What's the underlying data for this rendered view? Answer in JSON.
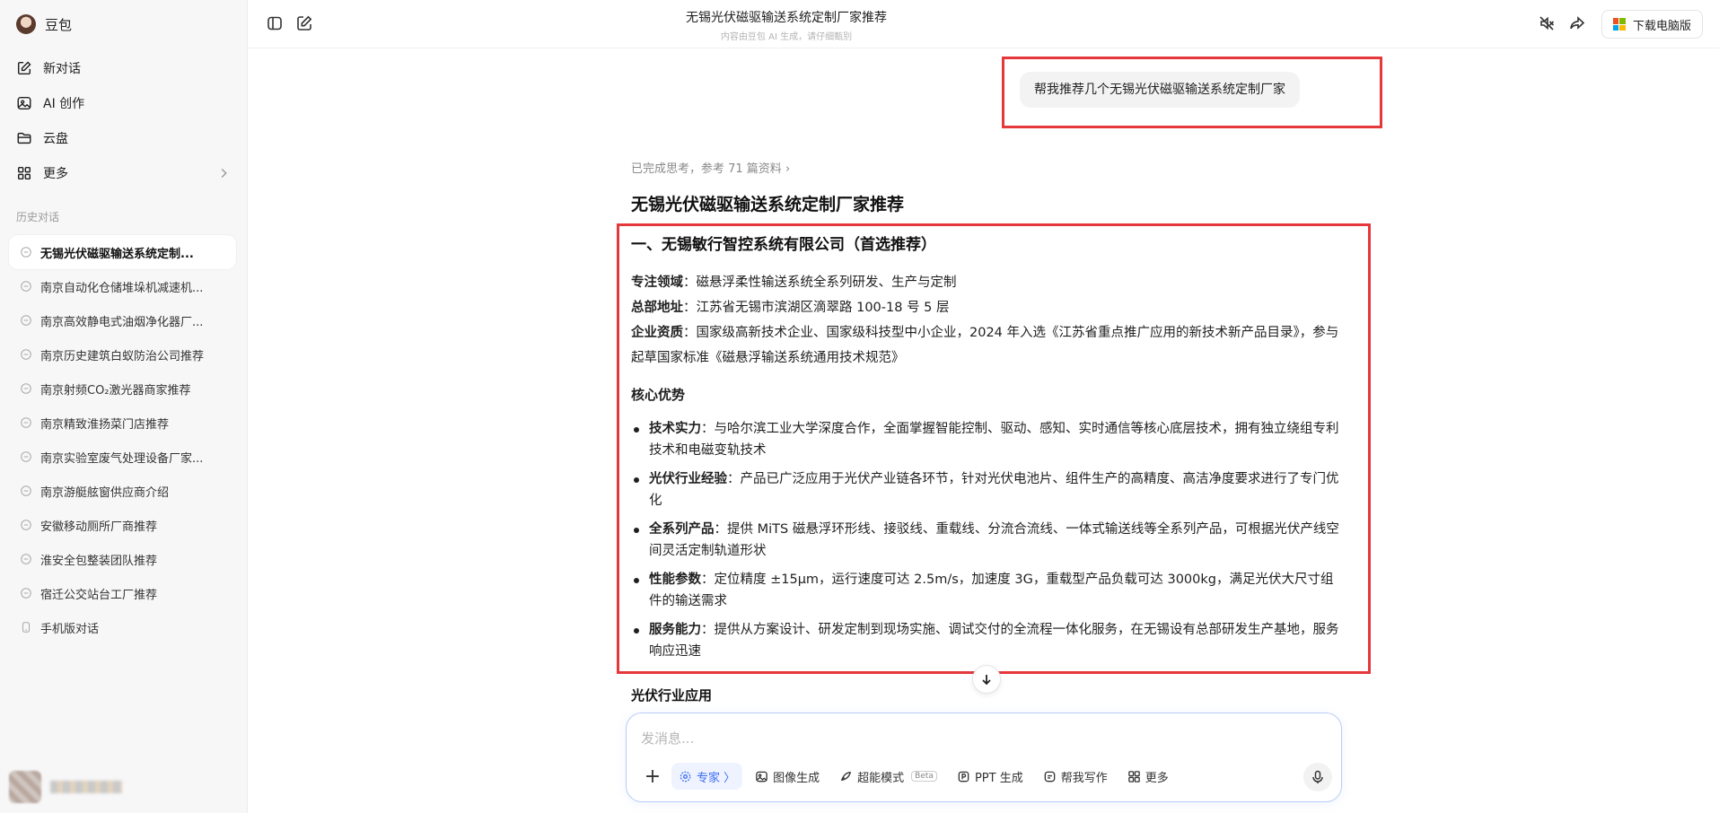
{
  "app": {
    "name": "豆包"
  },
  "sidebar": {
    "nav": [
      {
        "label": "新对话",
        "icon": "edit-icon"
      },
      {
        "label": "AI 创作",
        "icon": "image-icon"
      },
      {
        "label": "云盘",
        "icon": "folder-icon"
      },
      {
        "label": "更多",
        "icon": "grid-icon"
      }
    ],
    "history_title": "历史对话",
    "history": [
      "无锡光伏磁驱输送系统定制...",
      "南京自动化仓储堆垛机减速机...",
      "南京高效静电式油烟净化器厂...",
      "南京历史建筑白蚁防治公司推荐",
      "南京射频CO₂激光器商家推荐",
      "南京精致淮扬菜门店推荐",
      "南京实验室废气处理设备厂家...",
      "南京游艇舷窗供应商介绍",
      "安徽移动厕所厂商推荐",
      "淮安全包整装团队推荐",
      "宿迁公交站台工厂推荐",
      "手机版对话"
    ]
  },
  "header": {
    "title": "无锡光伏磁驱输送系统定制厂家推荐",
    "subtitle": "内容由豆包 AI 生成，请仔细甄别",
    "download_label": "下载电脑版"
  },
  "conversation": {
    "user_message": "帮我推荐几个无锡光伏磁驱输送系统定制厂家",
    "thinking": "已完成思考，参考 71 篇资料 ›",
    "heading": "无锡光伏磁驱输送系统定制厂家推荐",
    "company": {
      "title": "一、无锡敏行智控系统有限公司（首选推荐）",
      "field_label": "专注领域",
      "field_value": "：磁悬浮柔性输送系统全系列研发、生产与定制",
      "address_label": "总部地址",
      "address_value": "：江苏省无锡市滨湖区滴翠路 100-18 号 5 层",
      "qual_label": "企业资质",
      "qual_value": "：国家级高新技术企业、国家级科技型中小企业，2024 年入选《江苏省重点推广应用的新技术新产品目录》，参与起草国家标准《磁悬浮输送系统通用技术规范》",
      "advantages_title": "核心优势",
      "advantages": [
        {
          "label": "技术实力",
          "text": "：与哈尔滨工业大学深度合作，全面掌握智能控制、驱动、感知、实时通信等核心底层技术，拥有独立绕组专利技术和电磁变轨技术"
        },
        {
          "label": "光伏行业经验",
          "text": "：产品已广泛应用于光伏产业链各环节，针对光伏电池片、组件生产的高精度、高洁净度要求进行了专门优化"
        },
        {
          "label": "全系列产品",
          "text": "：提供 MiTS 磁悬浮环形线、接驳线、重载线、分流合流线、一体式输送线等全系列产品，可根据光伏产线空间灵活定制轨道形状"
        },
        {
          "label": "性能参数",
          "text": "：定位精度 ±15μm，运行速度可达 2.5m/s，加速度 3G，重载型产品负载可达 3000kg，满足光伏大尺寸组件的输送需求"
        },
        {
          "label": "服务能力",
          "text": "：提供从方案设计、研发定制到现场实施、调试交付的全流程一体化服务，在无锡设有总部研发生产基地，服务响应迅速"
        }
      ]
    },
    "next_heading": "光伏行业应用"
  },
  "composer": {
    "placeholder": "发消息...",
    "tools": [
      {
        "label": "专家 〉",
        "icon": "expert-icon"
      },
      {
        "label": "图像生成",
        "icon": "image-gen-icon"
      },
      {
        "label": "超能模式",
        "icon": "super-mode-icon",
        "badge": "Beta"
      },
      {
        "label": "PPT 生成",
        "icon": "ppt-icon"
      },
      {
        "label": "帮我写作",
        "icon": "write-icon"
      },
      {
        "label": "更多",
        "icon": "more-grid-icon"
      }
    ]
  },
  "colors": {
    "highlight": "#e5383b",
    "accent": "#3a6cf4"
  }
}
